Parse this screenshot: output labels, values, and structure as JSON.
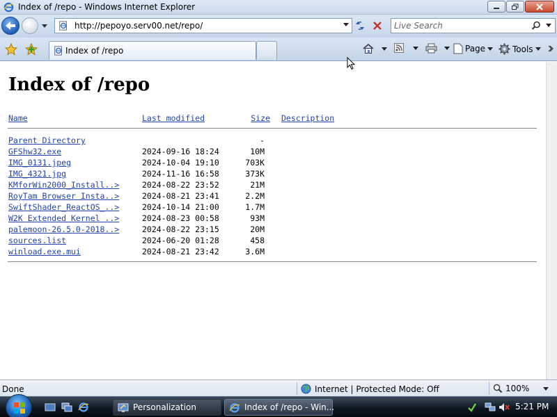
{
  "window": {
    "title": "Index of /repo - Windows Internet Explorer"
  },
  "addressbar": {
    "url": "http://pepoyo.serv00.net/repo/"
  },
  "search": {
    "placeholder": "Live Search"
  },
  "tab": {
    "label": "Index of /repo"
  },
  "commands": {
    "page_label": "Page",
    "tools_label": "Tools"
  },
  "page": {
    "heading": "Index of /repo",
    "columns": {
      "name": "Name",
      "last_modified": "Last modified",
      "size": "Size",
      "description": "Description"
    },
    "rows": [
      {
        "name": "Parent Directory",
        "date": "",
        "size": "-"
      },
      {
        "name": "GFShw32.exe",
        "date": "2024-09-16 18:24",
        "size": "10M"
      },
      {
        "name": "IMG_0131.jpeg",
        "date": "2024-10-04 19:10",
        "size": "703K"
      },
      {
        "name": "IMG_4321.jpg",
        "date": "2024-11-16 16:58",
        "size": "373K"
      },
      {
        "name": "KMforWin2000_Install..>",
        "date": "2024-08-22 23:52",
        "size": "21M"
      },
      {
        "name": "RoyTam Browser Insta..>",
        "date": "2024-08-21 23:41",
        "size": "2.2M"
      },
      {
        "name": "SwiftShader_ReactOS_..>",
        "date": "2024-10-14 21:00",
        "size": "1.7M"
      },
      {
        "name": "W2K Extended Kernel ..>",
        "date": "2024-08-23 00:58",
        "size": "93M"
      },
      {
        "name": "palemoon-26.5.0-2018..>",
        "date": "2024-08-22 23:15",
        "size": "20M"
      },
      {
        "name": "sources.list",
        "date": "2024-06-20 01:28",
        "size": "458"
      },
      {
        "name": "winload.exe.mui",
        "date": "2024-08-21 23:42",
        "size": "3.6M"
      }
    ]
  },
  "statusbar": {
    "status": "Done",
    "zone": "Internet | Protected Mode: Off",
    "zoom": "100%"
  },
  "taskbar": {
    "tasks": [
      {
        "label": "Personalization",
        "active": false
      },
      {
        "label": "Index of /repo - Win...",
        "active": true
      }
    ],
    "clock": "5:21 PM"
  }
}
